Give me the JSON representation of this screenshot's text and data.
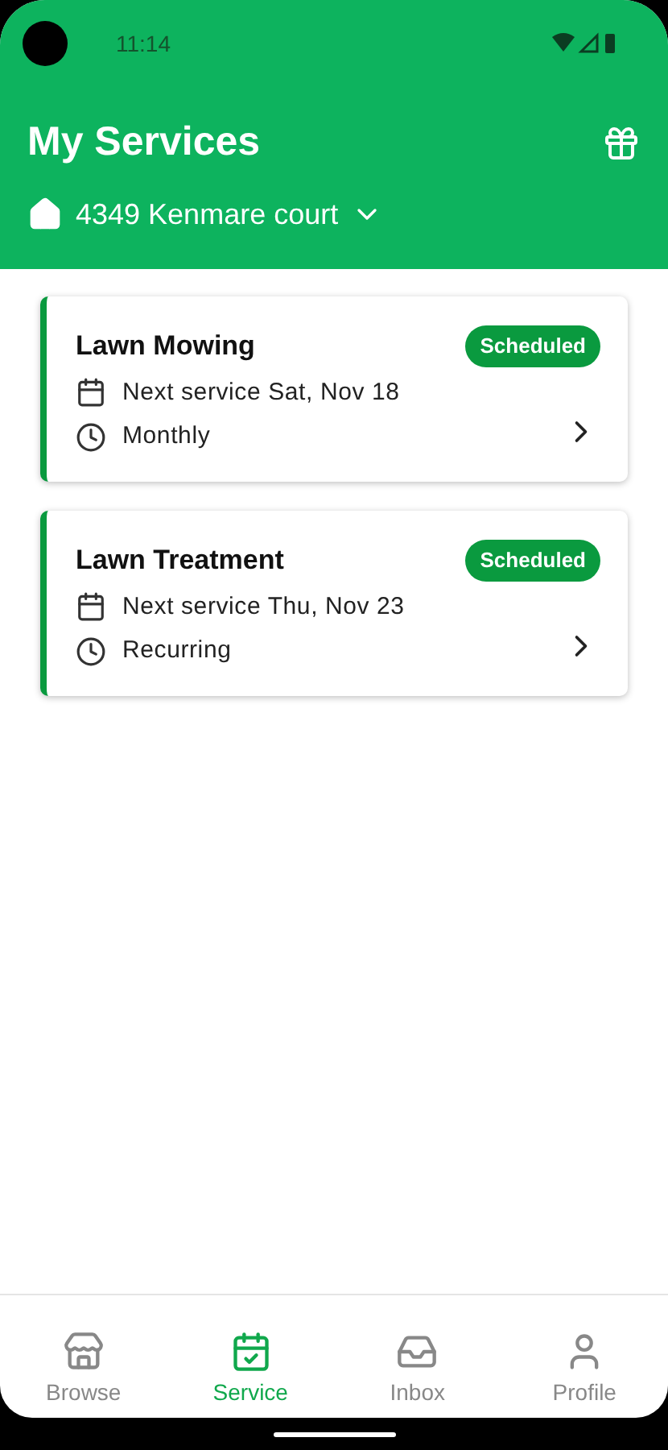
{
  "status_bar": {
    "time": "11:14"
  },
  "header": {
    "title": "My Services",
    "address": "4349 Kenmare court"
  },
  "services": [
    {
      "name": "Lawn Mowing",
      "status": "Scheduled",
      "details": [
        {
          "kind": "date",
          "text": "Next service Sat, Nov 18"
        },
        {
          "kind": "repeat",
          "text": "Monthly"
        }
      ]
    },
    {
      "name": "Lawn Treatment",
      "status": "Scheduled",
      "details": [
        {
          "kind": "date",
          "text": "Next service Thu, Nov 23"
        },
        {
          "kind": "repeat",
          "text": "Recurring"
        }
      ]
    }
  ],
  "nav": [
    {
      "kind": "browse",
      "label": "Browse",
      "selected": false
    },
    {
      "kind": "service",
      "label": "Service",
      "selected": true
    },
    {
      "kind": "inbox",
      "label": "Inbox",
      "selected": false
    },
    {
      "kind": "profile",
      "label": "Profile",
      "selected": false
    }
  ]
}
